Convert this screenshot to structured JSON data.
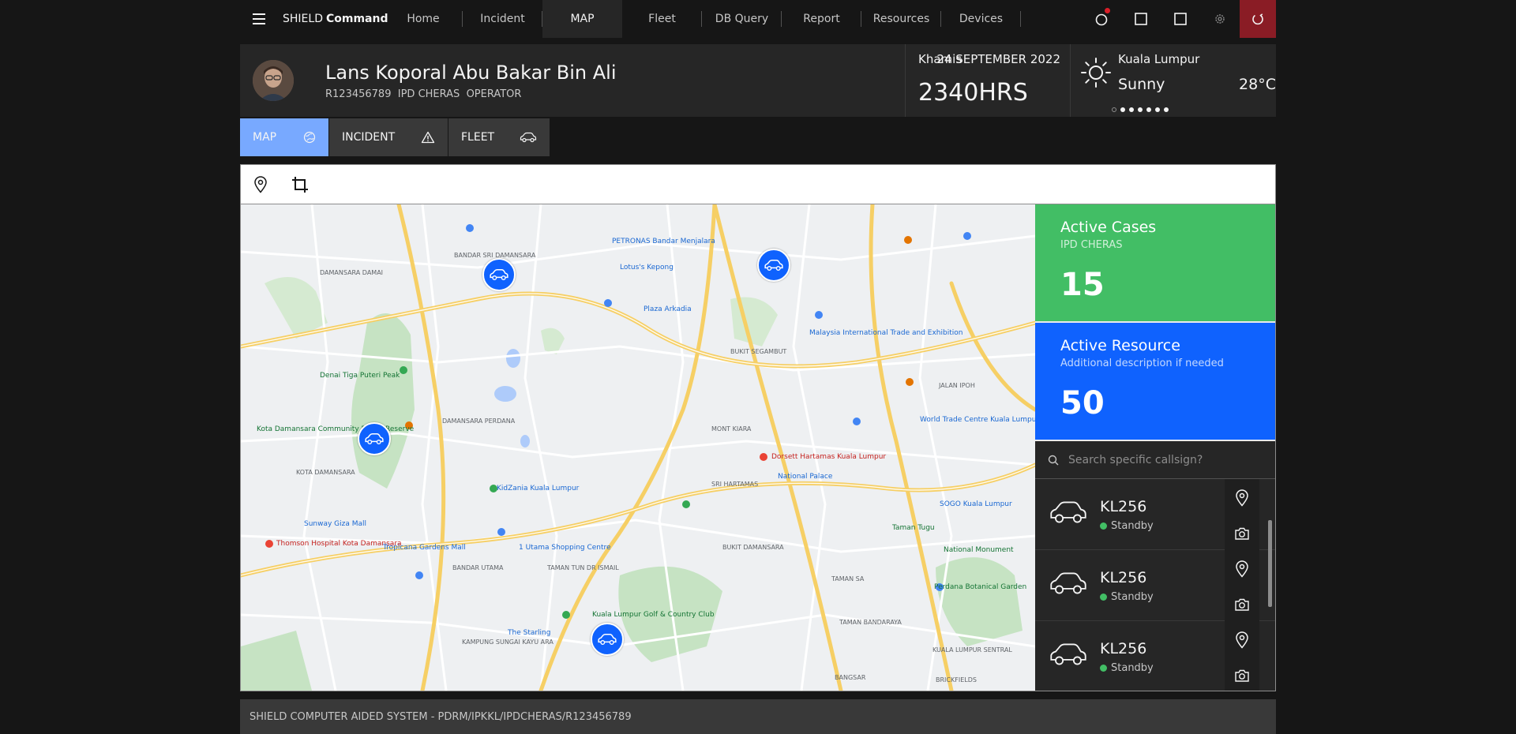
{
  "nav": {
    "brand_prefix": "SHIELD",
    "brand_bold": "Command",
    "items": [
      {
        "label": "Home",
        "active": false
      },
      {
        "label": "Incident",
        "active": false
      },
      {
        "label": "MAP",
        "active": true
      },
      {
        "label": "Fleet",
        "active": false
      },
      {
        "label": "DB Query",
        "active": false
      },
      {
        "label": "Report",
        "active": false
      },
      {
        "label": "Resources",
        "active": false
      },
      {
        "label": "Devices",
        "active": false
      }
    ],
    "icons": [
      "notification-icon",
      "square-icon",
      "square-outline-icon",
      "settings-icon",
      "power-icon"
    ]
  },
  "user": {
    "name": "Lans Koporal Abu Bakar Bin Ali",
    "id": "R123456789",
    "unit": "IPD CHERAS",
    "role": "OPERATOR"
  },
  "datetime": {
    "day": "Khamis",
    "date": "24 SEPTEMBER 2022",
    "time": "2340HRS"
  },
  "weather": {
    "city": "Kuala Lumpur",
    "condition": "Sunny",
    "temperature": "28°C",
    "icon": "sun-icon"
  },
  "tabs": [
    {
      "label": "MAP",
      "icon": "globe-icon",
      "active": true
    },
    {
      "label": "INCIDENT",
      "icon": "warning-icon",
      "active": false
    },
    {
      "label": "FLEET",
      "icon": "car-icon",
      "active": false
    }
  ],
  "map_tools": [
    "location-pin-icon",
    "crop-icon"
  ],
  "map_labels": {
    "bandar_sri_damansara": "BANDAR SRI DAMANSARA",
    "damansara_damai": "DAMANSARA DAMAI",
    "kota_damansara": "KOTA DAMANSARA",
    "damansara_perdana": "DAMANSARA PERDANA",
    "mont_kiara": "MONT KIARA",
    "sri_hartamas": "SRI HARTAMAS",
    "bukit_damansara": "BUKIT DAMANSARA",
    "bandar_utama": "BANDAR UTAMA",
    "taman_tun": "TAMAN TUN DR ISMAIL",
    "kampung_sungai_kayu_ara": "KAMPUNG SUNGAI KAYU ARA",
    "bangsar": "BANGSAR",
    "jalan_ipoh": "JALAN IPOH",
    "taman_sa": "TAMAN SA",
    "taman_bandaraya": "TAMAN BANDARAYA",
    "kuala_lumpur_sentral": "KUALA LUMPUR SENTRAL",
    "brickfields": "BRICKFIELDS",
    "segambut": "BUKIT SEGAMBUT",
    "petronas": "PETRONAS Bandar Menjalara",
    "plaza_arkadia": "Plaza Arkadia",
    "lotus_kepong": "Lotus's Kepong",
    "dorsett": "Dorsett Hartamas Kuala Lumpur",
    "national_palace": "National Palace",
    "kidzania": "KidZania Kuala Lumpur",
    "utama_mall": "1 Utama Shopping Centre",
    "sunway_giza": "Sunway Giza Mall",
    "thomson": "Thomson Hospital Kota Damansara",
    "tropicana_gardens": "Tropicana Gardens Mall",
    "the_starling": "The Starling",
    "kl_golf": "Kuala Lumpur Golf & Country Club",
    "perdana_garden": "Perdana Botanical Garden",
    "national_monument": "National Monument",
    "taman_tugu": "Taman Tugu",
    "sogo": "SOGO Kuala Lumpur",
    "world_trade": "World Trade Centre Kuala Lumpur",
    "matrade": "Malaysia International Trade and Exhibition",
    "denai": "Denai Tiga Puteri Peak",
    "kota_forest": "Kota Damansara Community Forest Reserve"
  },
  "stats": [
    {
      "title": "Active Cases",
      "subtitle": "IPD CHERAS",
      "value": "15",
      "color": "#42be65"
    },
    {
      "title": "Active Resource",
      "subtitle": "Additional description if needed",
      "value": "50",
      "color": "#0f62fe"
    }
  ],
  "search": {
    "placeholder": "Search specific callsign?"
  },
  "fleet_list": [
    {
      "callsign": "KL256",
      "status": "Standby"
    },
    {
      "callsign": "KL256",
      "status": "Standby"
    },
    {
      "callsign": "KL256",
      "status": "Standby"
    }
  ],
  "footer": {
    "text": "SHIELD COMPUTER AIDED SYSTEM - PDRM/IPKKL/IPDCHERAS/R123456789"
  }
}
